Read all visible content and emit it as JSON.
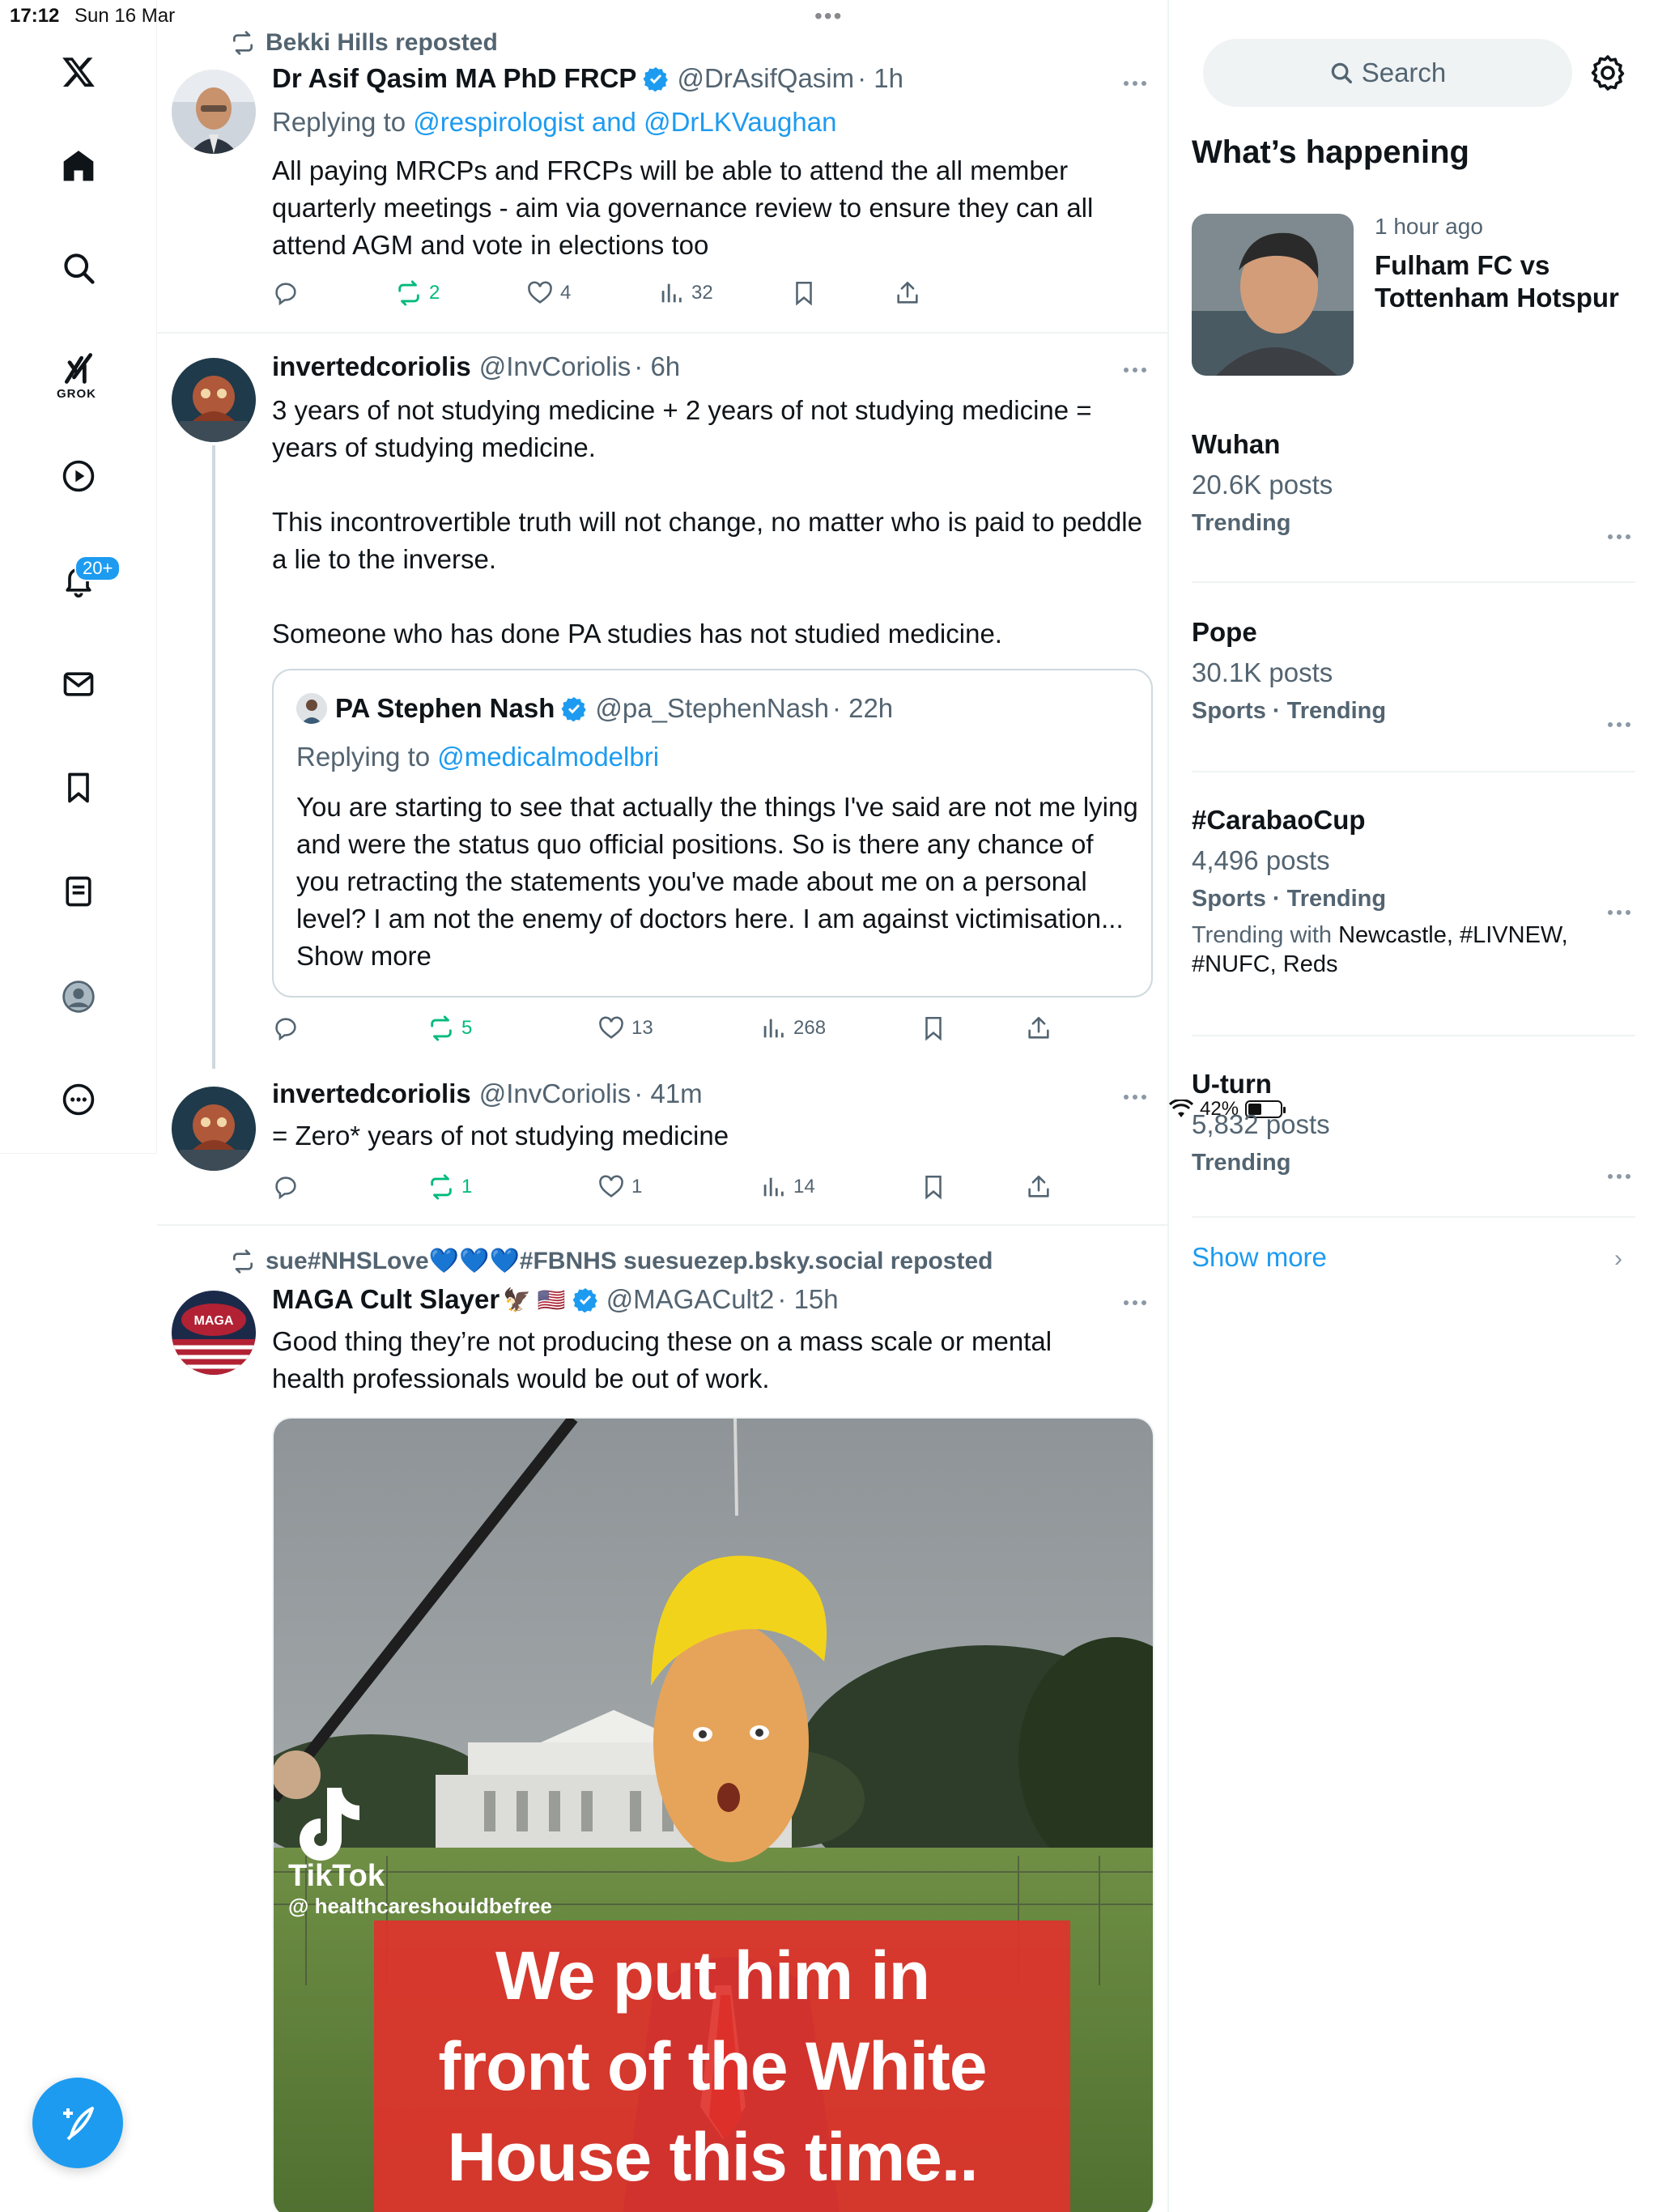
{
  "status_bar": {
    "time": "17:12",
    "date": "Sun 16 Mar",
    "battery": "42%",
    "battery_level": 0.42
  },
  "nav": {
    "items": [
      "X",
      "Home",
      "Explore",
      "Grok",
      "Video",
      "Notifications",
      "Messages",
      "Bookmarks",
      "Lists",
      "Profile",
      "More"
    ],
    "grok_label": "GROK",
    "notifications_badge": "20+",
    "compose_label": "Post"
  },
  "feed": {
    "tweets": [
      {
        "repost_by": "Bekki Hills reposted",
        "name": "Dr Asif Qasim MA PhD FRCP",
        "verified": true,
        "handle": "@DrAsifQasim",
        "time": "· 1h",
        "replying_prefix": "Replying to ",
        "replying_to": "@respirologist and @DrLKVaughan",
        "text": "All paying MRCPs and FRCPs will be able to attend the all member quarterly meetings - aim via governance review to ensure they can all attend AGM and vote in elections too",
        "reposts": "2",
        "likes": "4",
        "views": "32"
      },
      {
        "name": "invertedcoriolis",
        "handle": "@InvCoriolis",
        "time": "· 6h",
        "text": "3 years of not studying medicine + 2 years of not studying medicine = years of studying medicine.\n\nThis incontrovertible truth will not change, no matter who is paid to peddle a lie to the inverse.\n\nSomeone who has done PA studies has not studied medicine.",
        "quote": {
          "name": "PA Stephen Nash",
          "verified": true,
          "handle": "@pa_StephenNash",
          "time": "· 22h",
          "replying_prefix": "Replying to ",
          "replying_to": "@medicalmodelbri",
          "text": "You are starting to see that actually the things I've said are not me lying and were the status quo official positions. So is there any chance of you retracting the statements you've made about me on a personal level? I am not the enemy of doctors here. I am against victimisation... Show more"
        },
        "reposts": "5",
        "likes": "13",
        "views": "268"
      },
      {
        "name": "invertedcoriolis",
        "handle": "@InvCoriolis",
        "time": "· 41m",
        "text": "= Zero* years of not studying medicine",
        "reposts": "1",
        "likes": "1",
        "views": "14"
      },
      {
        "repost_by": "sue#NHSLove💙💙💙#FBNHS suesuezep.bsky.social reposted",
        "name": "MAGA Cult Slayer",
        "name_emoji": "🦅 🇺🇸",
        "verified": true,
        "handle": "@MAGACult2",
        "time": "· 15h",
        "text": "Good thing they’re not producing these on a mass scale or mental health professionals would be out of work.",
        "avatar_text": "MAGA",
        "media": {
          "tiktok_name": "TikTok",
          "tiktok_handle": "@ healthcareshouldbefree",
          "caption_lines": [
            "We put him in",
            "front of the White",
            "House this time.."
          ]
        }
      }
    ]
  },
  "sidebar": {
    "search_placeholder": "Search",
    "section_title": "What’s happening",
    "event": {
      "time_ago": "1 hour ago",
      "title": "Fulham FC vs Tottenham Hotspur"
    },
    "trends": [
      {
        "name": "Wuhan",
        "posts": "20.6K posts",
        "category": "Trending"
      },
      {
        "name": "Pope",
        "posts": "30.1K posts",
        "category": "Sports · Trending"
      },
      {
        "name": "#CarabaoCup",
        "posts": "4,496 posts",
        "category": "Sports · Trending",
        "trending_with_prefix": "Trending with ",
        "trending_with": "Newcastle, #LIVNEW, #NUFC, Reds"
      },
      {
        "name": "U-turn",
        "posts": "5,832 posts",
        "category": "Trending"
      }
    ],
    "show_more": "Show more"
  },
  "colors": {
    "accent": "#1d9bf0",
    "repost_green": "#00ba7c",
    "secondary_text": "#536471",
    "border": "#eff3f4"
  }
}
